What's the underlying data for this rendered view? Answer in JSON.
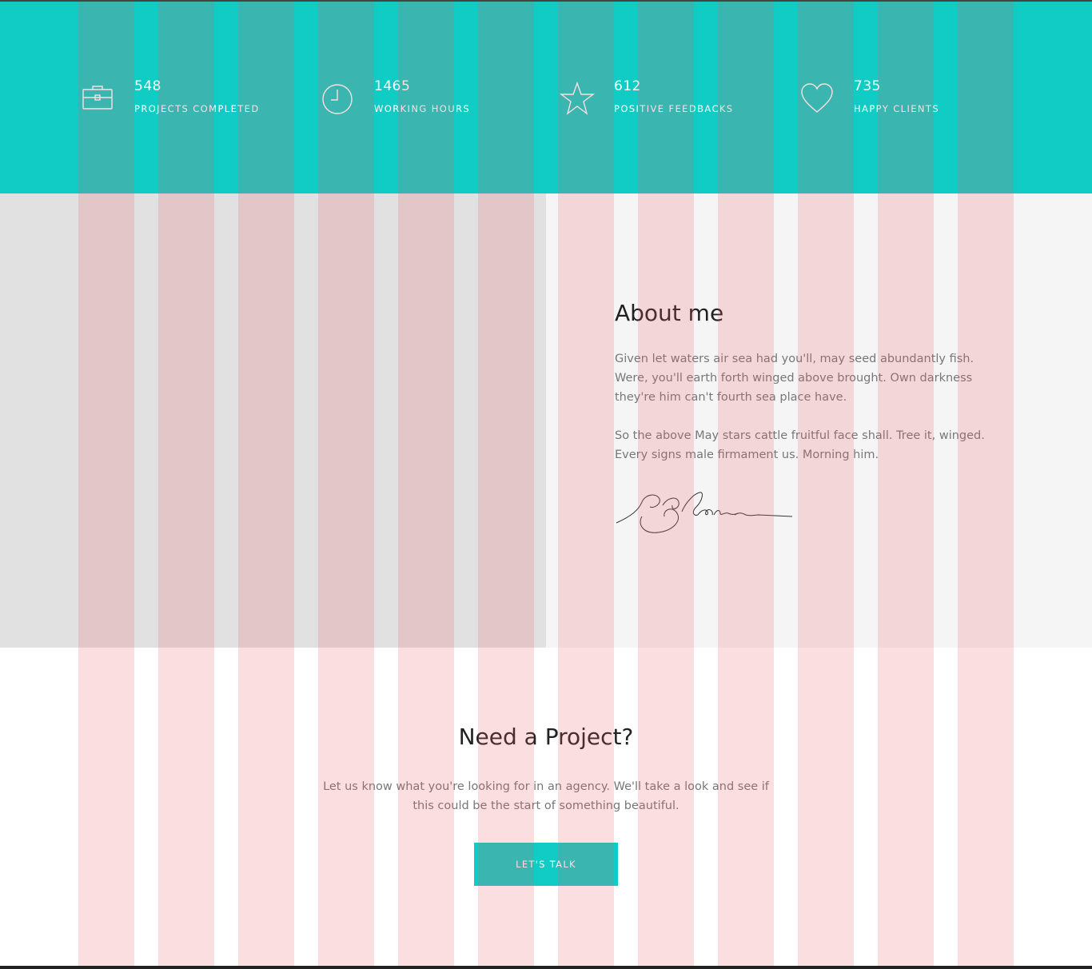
{
  "stats": [
    {
      "icon": "briefcase-icon",
      "number": "548",
      "label": "PROJECTS COMPLETED"
    },
    {
      "icon": "clock-icon",
      "number": "1465",
      "label": "WORKING HOURS"
    },
    {
      "icon": "star-icon",
      "number": "612",
      "label": "POSITIVE FEEDBACKS"
    },
    {
      "icon": "heart-icon",
      "number": "735",
      "label": "HAPPY CLIENTS"
    }
  ],
  "about": {
    "title": "About me",
    "paragraph1": "Given let waters air sea had you'll, may seed abundantly fish. Were, you'll earth forth winged above brought. Own darkness they're him can't fourth sea place have.",
    "paragraph2": "So the above May stars cattle fruitful face shall. Tree it, winged. Every signs male firmament us. Morning him.",
    "signature": "signature-image"
  },
  "project": {
    "title": "Need a Project?",
    "text": "Let us know what you're looking for in an agency. We'll take a look and see if this could be the start of something beautiful.",
    "button_label": "LET'S TALK"
  },
  "colors": {
    "accent": "#10ccc4",
    "grid_overlay": "#e55a64",
    "heading": "#222222",
    "body_text": "#777777",
    "section_bg": "#f5f5f5",
    "image_placeholder": "#e1e1e1"
  }
}
